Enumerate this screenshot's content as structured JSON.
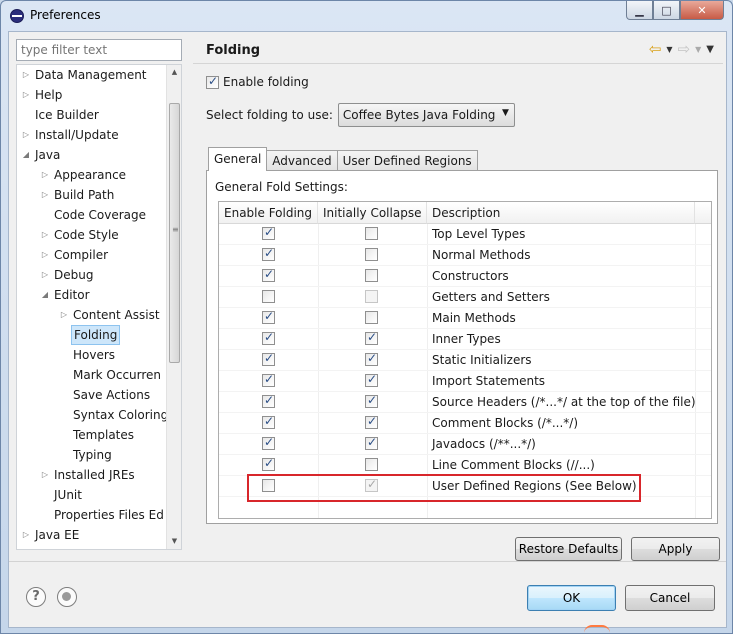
{
  "window": {
    "title": "Preferences"
  },
  "filter": {
    "placeholder": "type filter text"
  },
  "tree": [
    {
      "label": "Data Management",
      "indent": 0,
      "twisty": "collapsed"
    },
    {
      "label": "Help",
      "indent": 0,
      "twisty": "collapsed"
    },
    {
      "label": "Ice Builder",
      "indent": 0,
      "twisty": "none"
    },
    {
      "label": "Install/Update",
      "indent": 0,
      "twisty": "collapsed"
    },
    {
      "label": "Java",
      "indent": 0,
      "twisty": "expanded"
    },
    {
      "label": "Appearance",
      "indent": 1,
      "twisty": "collapsed"
    },
    {
      "label": "Build Path",
      "indent": 1,
      "twisty": "collapsed"
    },
    {
      "label": "Code Coverage",
      "indent": 1,
      "twisty": "none"
    },
    {
      "label": "Code Style",
      "indent": 1,
      "twisty": "collapsed"
    },
    {
      "label": "Compiler",
      "indent": 1,
      "twisty": "collapsed"
    },
    {
      "label": "Debug",
      "indent": 1,
      "twisty": "collapsed"
    },
    {
      "label": "Editor",
      "indent": 1,
      "twisty": "expanded"
    },
    {
      "label": "Content Assist",
      "indent": 2,
      "twisty": "collapsed"
    },
    {
      "label": "Folding",
      "indent": 2,
      "twisty": "none",
      "selected": true
    },
    {
      "label": "Hovers",
      "indent": 2,
      "twisty": "none"
    },
    {
      "label": "Mark Occurren",
      "indent": 2,
      "twisty": "none"
    },
    {
      "label": "Save Actions",
      "indent": 2,
      "twisty": "none"
    },
    {
      "label": "Syntax Coloring",
      "indent": 2,
      "twisty": "none"
    },
    {
      "label": "Templates",
      "indent": 2,
      "twisty": "none"
    },
    {
      "label": "Typing",
      "indent": 2,
      "twisty": "none"
    },
    {
      "label": "Installed JREs",
      "indent": 1,
      "twisty": "collapsed"
    },
    {
      "label": "JUnit",
      "indent": 1,
      "twisty": "none"
    },
    {
      "label": "Properties Files Ed",
      "indent": 1,
      "twisty": "none"
    },
    {
      "label": "Java EE",
      "indent": 0,
      "twisty": "collapsed"
    }
  ],
  "page": {
    "title": "Folding",
    "enable_folding_label": "Enable folding",
    "enable_folding_checked": true,
    "select_label": "Select folding to use:",
    "select_value": "Coffee Bytes Java Folding",
    "tabs": [
      "General",
      "Advanced",
      "User Defined Regions"
    ],
    "active_tab": "General",
    "section_label": "General Fold Settings:",
    "columns": [
      "Enable Folding",
      "Initially Collapse",
      "Description"
    ],
    "rows": [
      {
        "enable": true,
        "collapse": false,
        "description": "Top Level Types"
      },
      {
        "enable": true,
        "collapse": false,
        "description": "Normal Methods"
      },
      {
        "enable": true,
        "collapse": false,
        "description": "Constructors"
      },
      {
        "enable": false,
        "collapse": false,
        "description": "Getters and Setters",
        "collapse_disabled": true
      },
      {
        "enable": true,
        "collapse": false,
        "description": "Main Methods"
      },
      {
        "enable": true,
        "collapse": true,
        "description": "Inner Types"
      },
      {
        "enable": true,
        "collapse": true,
        "description": "Static Initializers"
      },
      {
        "enable": true,
        "collapse": true,
        "description": "Import Statements"
      },
      {
        "enable": true,
        "collapse": true,
        "description": "Source Headers (/*...*/ at the top of the file)"
      },
      {
        "enable": true,
        "collapse": true,
        "description": "Comment Blocks (/*...*/)"
      },
      {
        "enable": true,
        "collapse": true,
        "description": "Javadocs (/**...*/)"
      },
      {
        "enable": true,
        "collapse": false,
        "description": "Line Comment Blocks (//...)"
      },
      {
        "enable": false,
        "collapse": true,
        "description": "User Defined Regions (See Below)",
        "collapse_disabled": true
      }
    ]
  },
  "buttons": {
    "restore_defaults": "Restore Defaults",
    "apply": "Apply",
    "ok": "OK",
    "cancel": "Cancel"
  },
  "colors": {
    "highlight_box": "#d8262b",
    "selection": "#cde6fa",
    "back_arrow": "#d9a11b"
  }
}
